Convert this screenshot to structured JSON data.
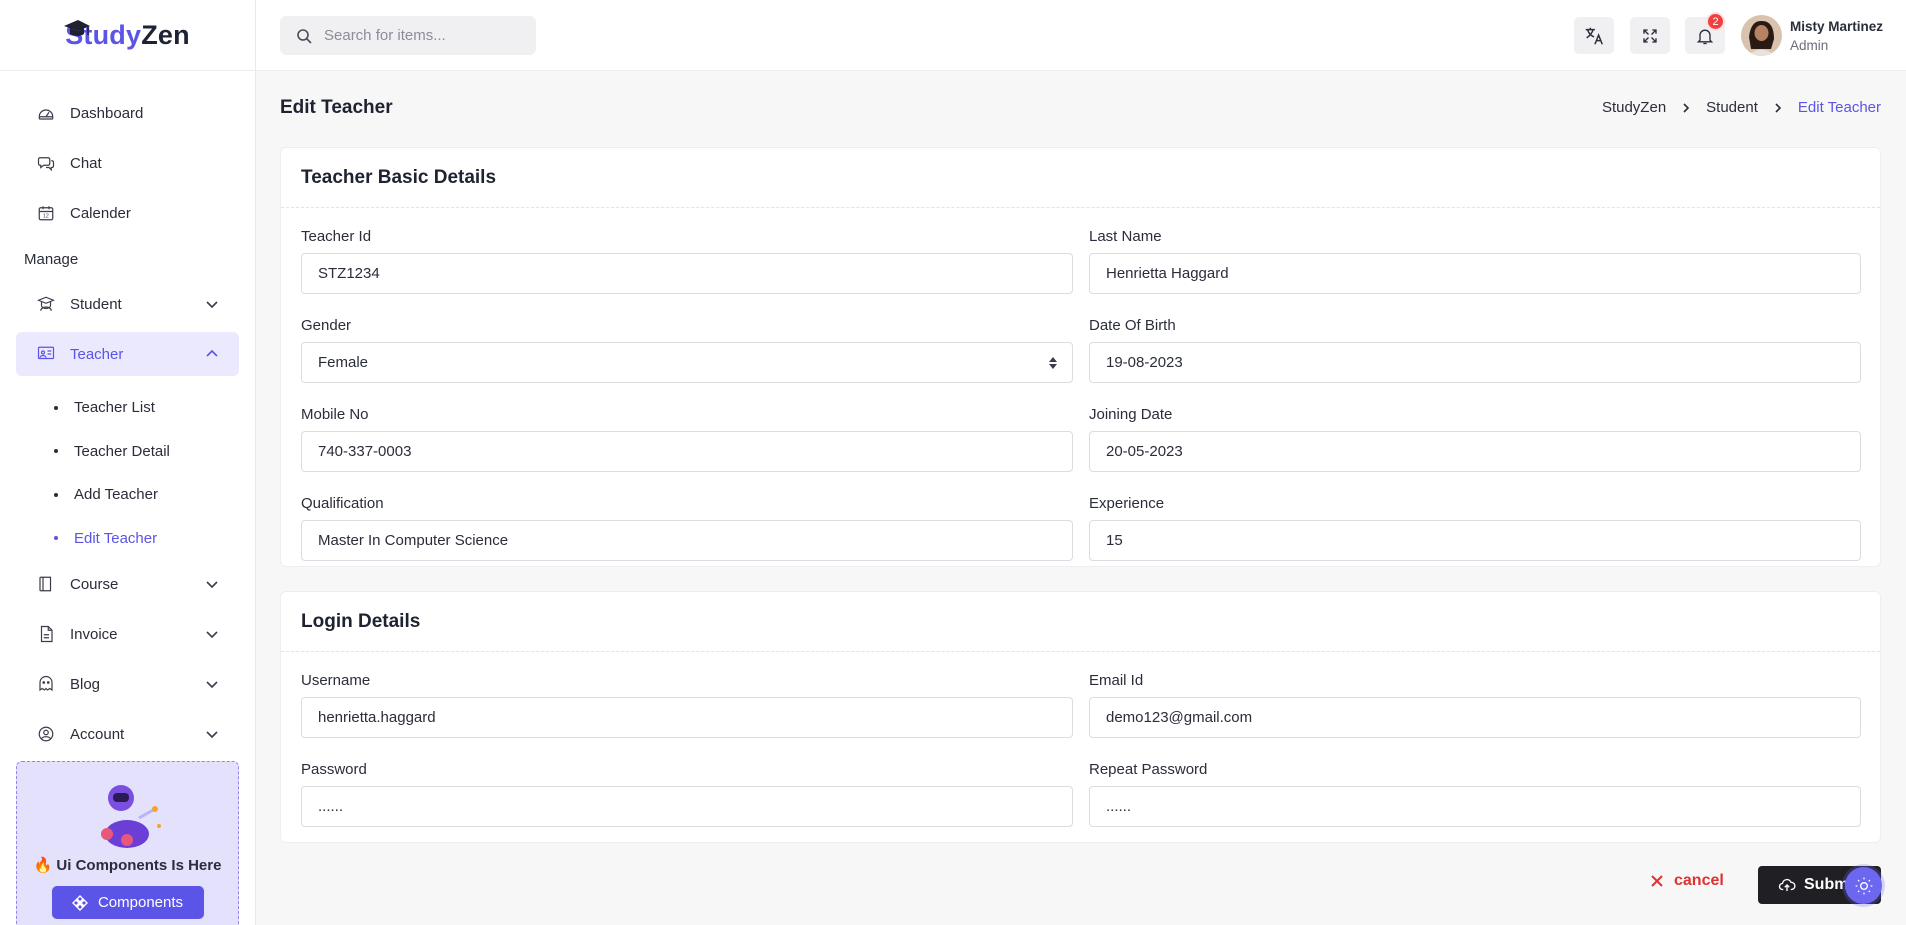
{
  "brand": {
    "part1": "Study",
    "part2": "Zen"
  },
  "search": {
    "placeholder": "Search for items..."
  },
  "topbar": {
    "notification_count": "2",
    "user": {
      "name": "Misty Martinez",
      "role": "Admin"
    }
  },
  "sidebar": {
    "top_items": [
      {
        "label": "Dashboard",
        "icon": "dashboard-icon"
      },
      {
        "label": "Chat",
        "icon": "chat-icon"
      },
      {
        "label": "Calender",
        "icon": "calendar-icon"
      }
    ],
    "manage_title": "Manage",
    "student": {
      "label": "Student",
      "icon": "student-icon"
    },
    "teacher": {
      "label": "Teacher",
      "icon": "teacher-icon"
    },
    "teacher_sub": [
      "Teacher List",
      "Teacher Detail",
      "Add Teacher",
      "Edit Teacher"
    ],
    "bottom_items": [
      {
        "label": "Course",
        "icon": "book-icon"
      },
      {
        "label": "Invoice",
        "icon": "invoice-icon"
      },
      {
        "label": "Blog",
        "icon": "blog-icon"
      },
      {
        "label": "Account",
        "icon": "account-icon"
      }
    ],
    "promo": {
      "text": "🔥 Ui Components Is Here",
      "button": "Components"
    }
  },
  "page": {
    "title": "Edit Teacher",
    "breadcrumb": [
      "StudyZen",
      "Student",
      "Edit Teacher"
    ]
  },
  "basic": {
    "title": "Teacher Basic Details",
    "teacher_id": {
      "label": "Teacher Id",
      "value": "STZ1234"
    },
    "last_name": {
      "label": "Last Name",
      "value": "Henrietta Haggard"
    },
    "gender": {
      "label": "Gender",
      "value": "Female"
    },
    "dob": {
      "label": "Date Of Birth",
      "value": "19-08-2023"
    },
    "mobile": {
      "label": "Mobile No",
      "value": "740-337-0003"
    },
    "joining": {
      "label": "Joining Date",
      "value": "20-05-2023"
    },
    "qualification": {
      "label": "Qualification",
      "value": "Master In Computer Science"
    },
    "experience": {
      "label": "Experience",
      "value": "15"
    }
  },
  "login": {
    "title": "Login Details",
    "username": {
      "label": "Username",
      "value": "henrietta.haggard"
    },
    "email": {
      "label": "Email Id",
      "value": "demo123@gmail.com"
    },
    "password": {
      "label": "Password",
      "value": "......"
    },
    "repeat_password": {
      "label": "Repeat Password",
      "value": "......"
    }
  },
  "actions": {
    "cancel": "cancel",
    "submit": "Submit"
  },
  "colors": {
    "accent": "#5b54e6",
    "danger": "#e03131",
    "dark": "#1f1f24"
  }
}
